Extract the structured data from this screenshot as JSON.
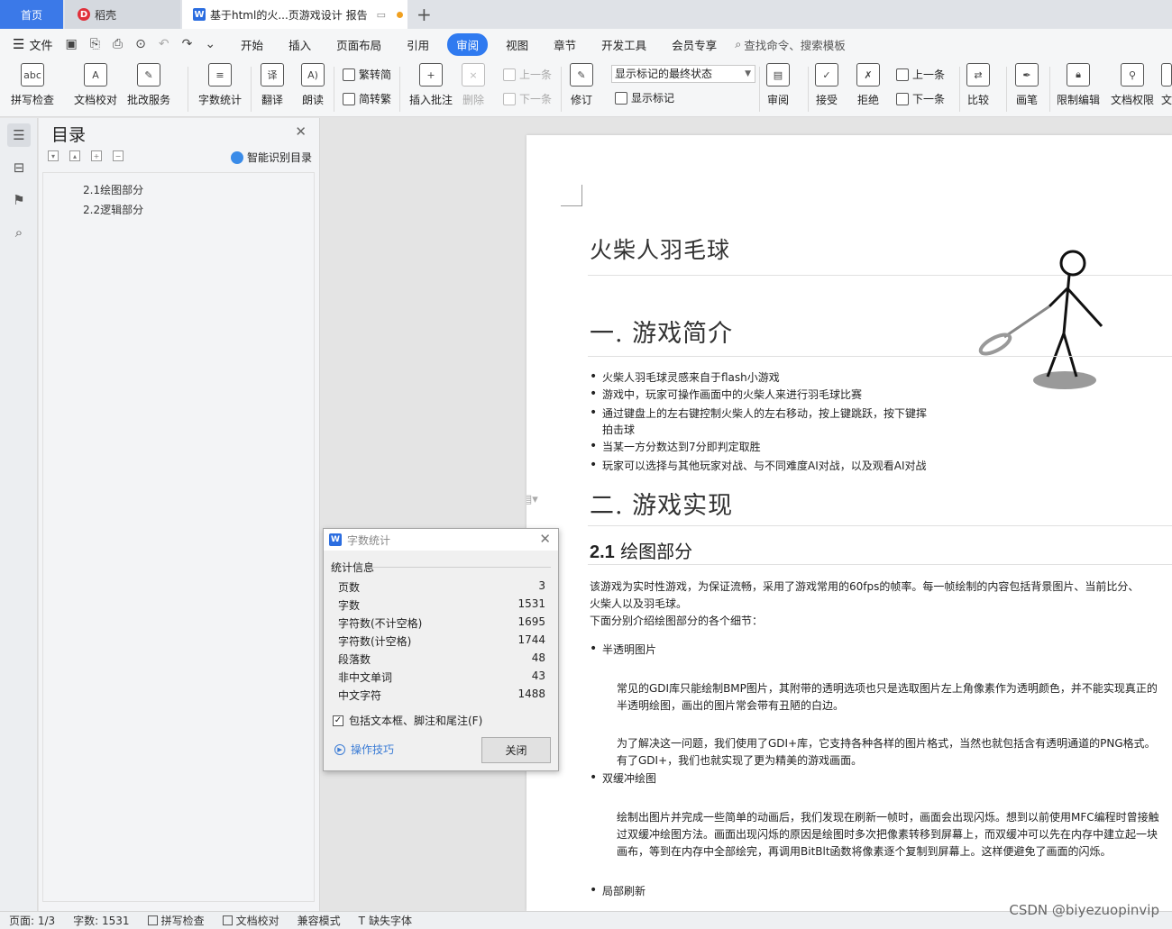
{
  "tabs": {
    "home": "首页",
    "daoke": "稻壳",
    "doc": "基于html的火...页游戏设计 报告"
  },
  "menu": {
    "file": "文件",
    "items": [
      "开始",
      "插入",
      "页面布局",
      "引用",
      "审阅",
      "视图",
      "章节",
      "开发工具",
      "会员专享"
    ],
    "search": "查找命令、搜索模板"
  },
  "ribbon": {
    "spellcheck": "拼写检查",
    "doc_proof": "文档校对",
    "batch_service": "批改服务",
    "word_count": "字数统计",
    "translate": "翻译",
    "read_aloud": "朗读",
    "trad_to_simp": "繁转简",
    "simp_to_trad": "简转繁",
    "insert_comment": "插入批注",
    "delete": "删除",
    "prev_comment": "上一条",
    "next_comment": "下一条",
    "revise": "修订",
    "markup_select": "显示标记的最终状态",
    "show_markup": "显示标记",
    "review": "审阅",
    "accept": "接受",
    "reject": "拒绝",
    "prev": "上一条",
    "next": "下一条",
    "compare": "比较",
    "pen": "画笔",
    "restrict_edit": "限制编辑",
    "doc_rights": "文档权限",
    "tail": "文"
  },
  "toc": {
    "title": "目录",
    "smart": "智能识别目录",
    "items": [
      "2.1绘图部分",
      "2.2逻辑部分"
    ]
  },
  "document": {
    "title": "火柴人羽毛球",
    "h1_1": "一. 游戏简介",
    "bullets1": [
      "火柴人羽毛球灵感来自于flash小游戏",
      "游戏中，玩家可操作画面中的火柴人来进行羽毛球比赛",
      "通过键盘上的左右键控制火柴人的左右移动，按上键跳跃，按下键挥拍击球",
      "当某一方分数达到7分即判定取胜",
      "玩家可以选择与其他玩家对战、与不同难度AI对战，以及观看AI对战"
    ],
    "h1_2": "二. 游戏实现",
    "h2_num": "2.1",
    "h2_text": "绘图部分",
    "p1": "该游戏为实时性游戏，为保证流畅，采用了游戏常用的60fps的帧率。每一帧绘制的内容包括背景图片、当前比分、火柴人以及羽毛球。",
    "p2": "下面分别介绍绘图部分的各个细节：",
    "b_translucent": "半透明图片",
    "p3": "常见的GDI库只能绘制BMP图片，其附带的透明选项也只是选取图片左上角像素作为透明颜色，并不能实现真正的半透明绘图，画出的图片常会带有丑陋的白边。",
    "p4": "为了解决这一问题，我们使用了GDI+库，它支持各种各样的图片格式，当然也就包括含有透明通道的PNG格式。有了GDI+，我们也就实现了更为精美的游戏画面。",
    "b_double": "双缓冲绘图",
    "p5": "绘制出图片并完成一些简单的动画后，我们发现在刷新一帧时，画面会出现闪烁。想到以前使用MFC编程时曾接触过双缓冲绘图方法。画面出现闪烁的原因是绘图时多次把像素转移到屏幕上，而双缓冲可以先在内存中建立起一块画布，等到在内存中全部绘完，再调用BitBlt函数将像素逐个复制到屏幕上。这样便避免了画面的闪烁。",
    "b_partial": "局部刷新"
  },
  "word_count": {
    "title": "字数统计",
    "section": "统计信息",
    "rows": [
      {
        "label": "页数",
        "value": "3"
      },
      {
        "label": "字数",
        "value": "1531"
      },
      {
        "label": "字符数(不计空格)",
        "value": "1695"
      },
      {
        "label": "字符数(计空格)",
        "value": "1744"
      },
      {
        "label": "段落数",
        "value": "48"
      },
      {
        "label": "非中文单词",
        "value": "43"
      },
      {
        "label": "中文字符",
        "value": "1488"
      }
    ],
    "include_label": "包括文本框、脚注和尾注(F)",
    "tips": "操作技巧",
    "close": "关闭"
  },
  "status": {
    "page": "页面: 1/3",
    "words": "字数: 1531",
    "spell": "拼写检查",
    "proof": "文档校对",
    "compat": "兼容模式",
    "missing_font": "缺失字体"
  },
  "watermark": "CSDN @biyezuopinvip",
  "colors": {
    "accent": "#2f7af0",
    "home_tab": "#3b79e8"
  }
}
